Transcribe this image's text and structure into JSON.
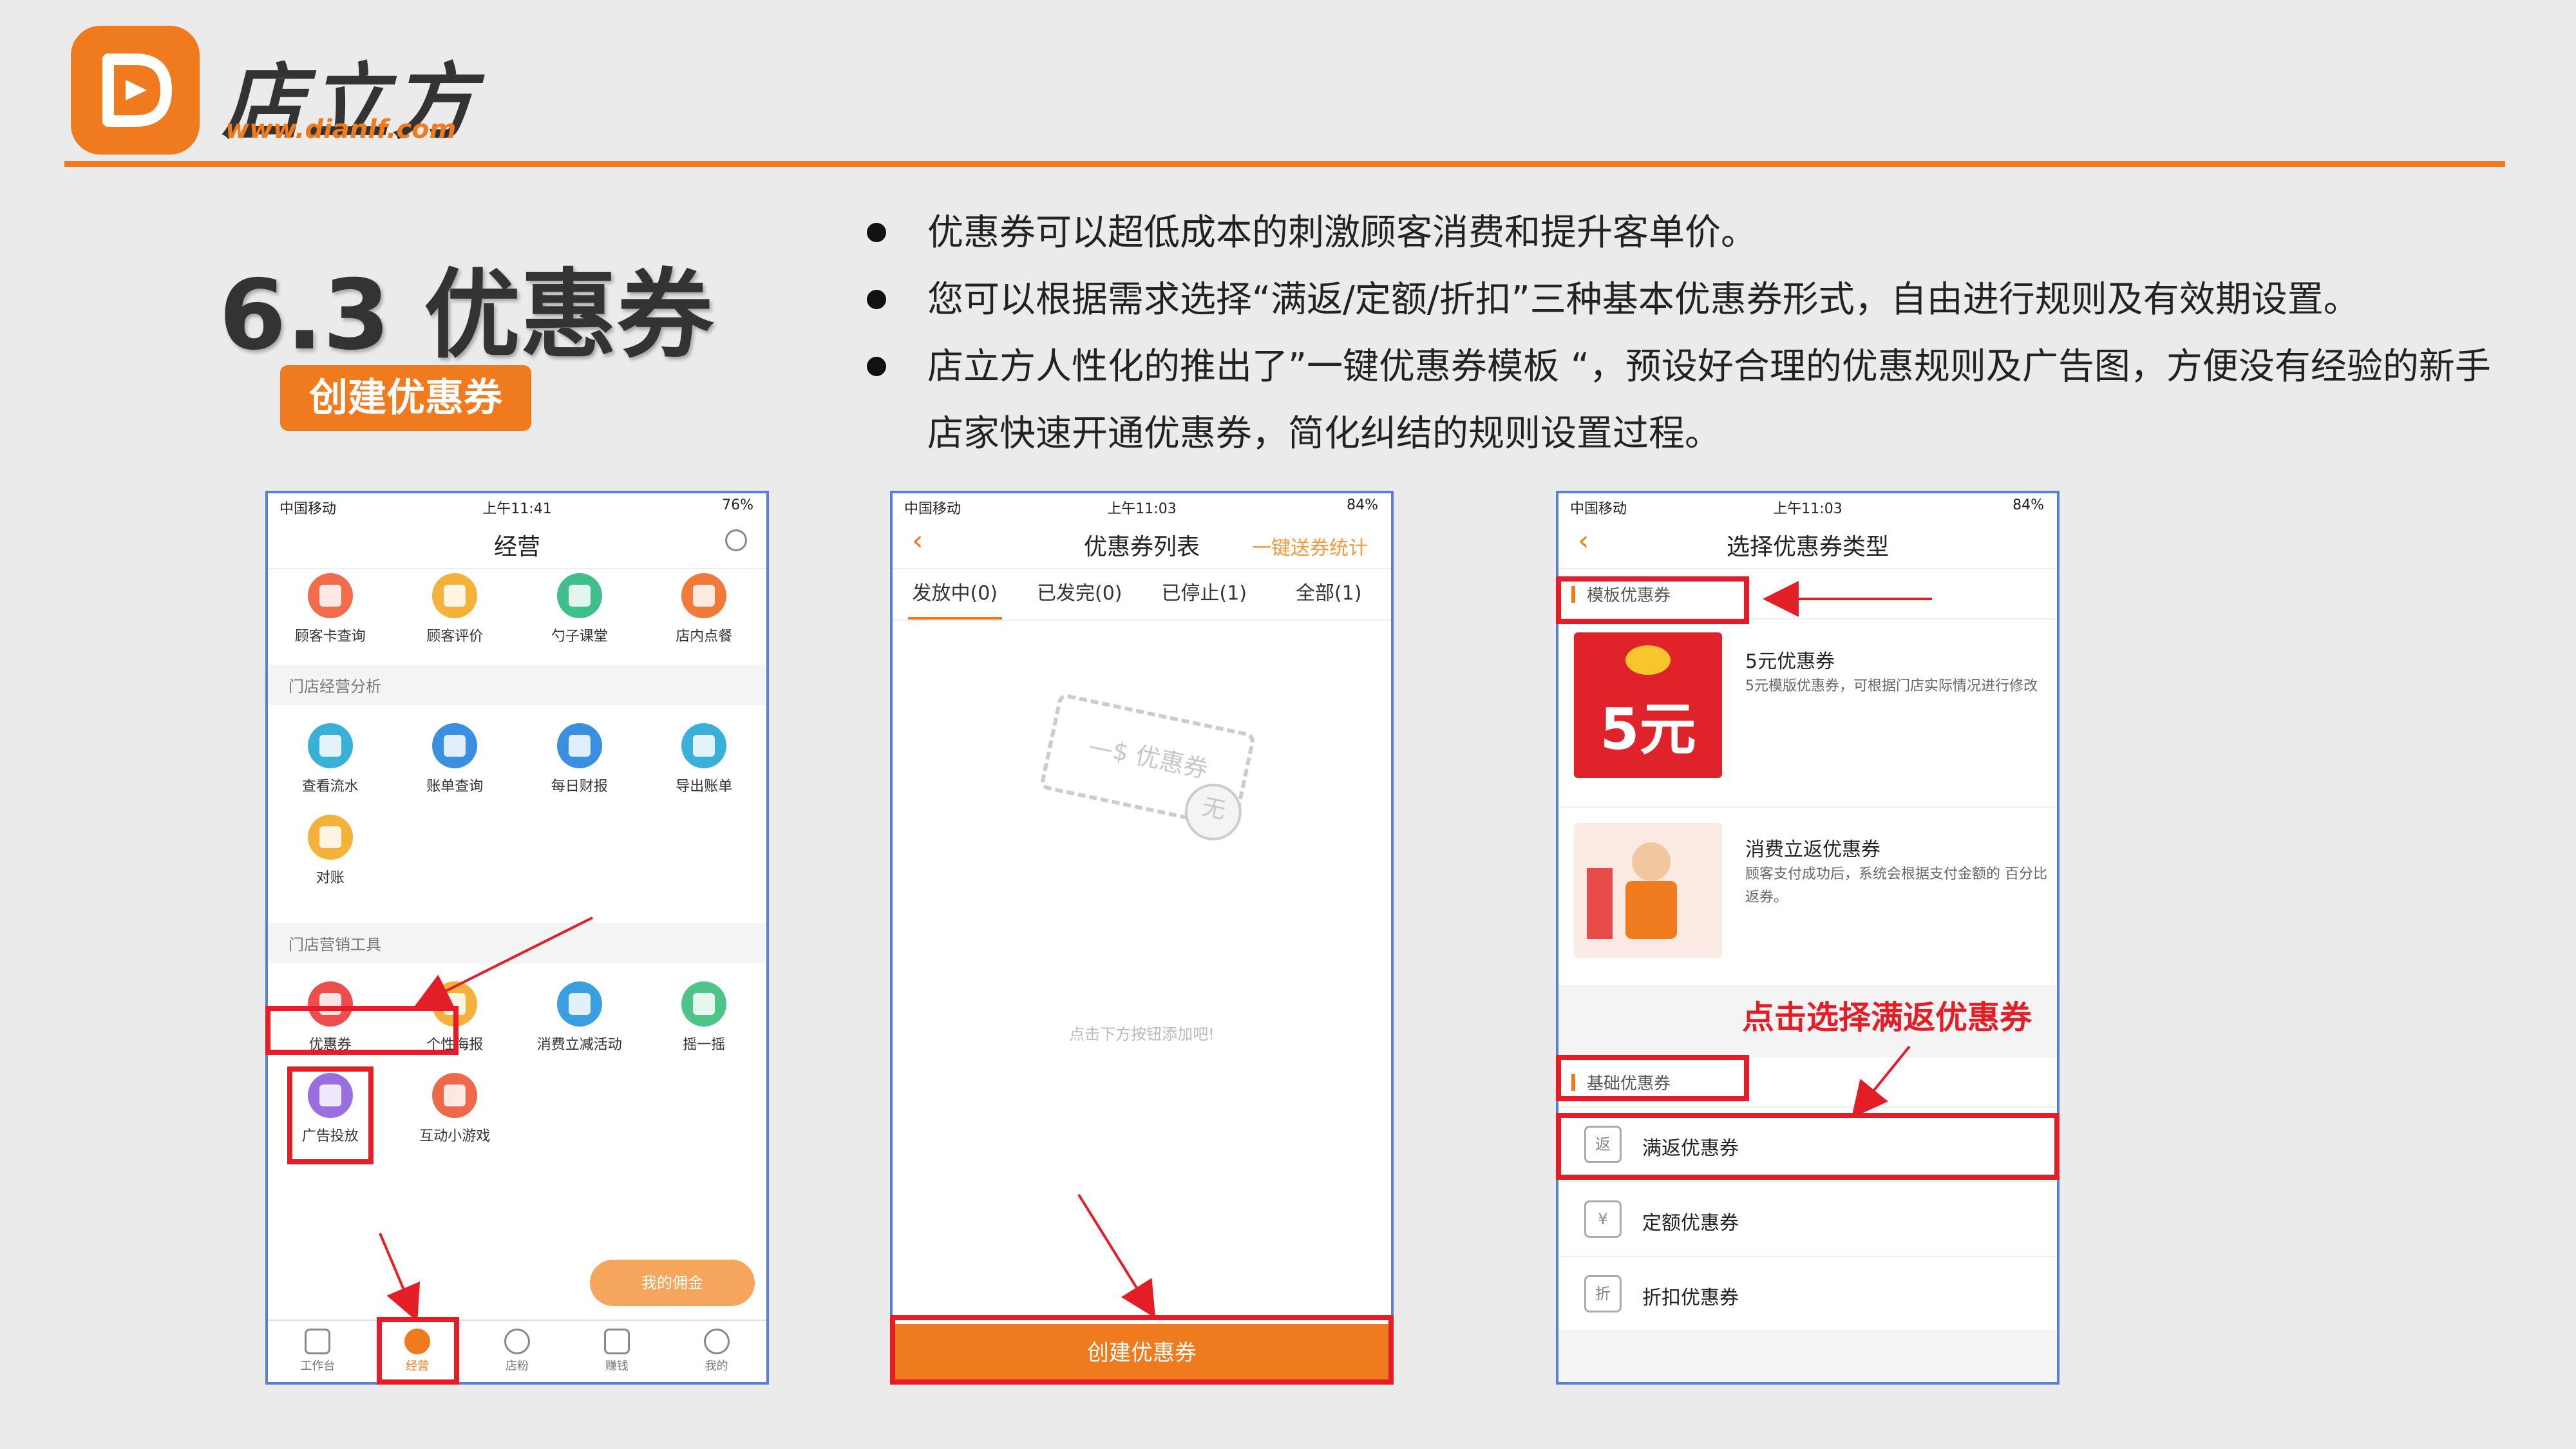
{
  "brand": {
    "name": "店立方",
    "url": "www.dianlf.com"
  },
  "slide": {
    "title": "6.3 优惠券",
    "create_button": "创建优惠券",
    "bullets": [
      "优惠券可以超低成本的刺激顾客消费和提升客单价。",
      "您可以根据需求选择“满返/定额/折扣”三种基本优惠券形式，自由进行规则及有效期设置。",
      "店立方人性化的推出了”一键优惠券模板 “，预设好合理的优惠规则及广告图，方便没有经验的新手店家快速开通优惠券，简化纠结的规则设置过程。"
    ],
    "annotation": "点击选择满返优惠券"
  },
  "phone1": {
    "status": {
      "carrier": "中国移动",
      "time": "上午11:41",
      "battery": "76%"
    },
    "title": "经营",
    "row1": [
      "顾客卡查询",
      "顾客评价",
      "勺子课堂",
      "店内点餐"
    ],
    "section_analysis": "门店经营分析",
    "row2": [
      "查看流水",
      "账单查询",
      "每日财报",
      "导出账单"
    ],
    "row3": [
      "对账"
    ],
    "section_marketing": "门店营销工具",
    "row4": [
      "优惠券",
      "个性海报",
      "消费立减活动",
      "摇一摇"
    ],
    "row5": [
      "广告投放",
      "互动小游戏"
    ],
    "commission_button": "我的佣金",
    "tabbar": [
      "工作台",
      "经营",
      "店粉",
      "赚钱",
      "我的"
    ],
    "colors": {
      "row1": [
        "#f26b4a",
        "#f5b23a",
        "#3fbf8c",
        "#f07a3a"
      ],
      "row2": [
        "#3ab0d8",
        "#3a8fe0",
        "#3a8fe0",
        "#3ab0d8"
      ],
      "row3": [
        "#f5b23a"
      ],
      "row4": [
        "#ec4e4e",
        "#f5b23a",
        "#3a9ee0",
        "#4fc48a"
      ],
      "row5": [
        "#9b6ee0",
        "#f0684a"
      ]
    }
  },
  "phone2": {
    "status": {
      "carrier": "中国移动",
      "time": "上午11:03",
      "battery": "84%"
    },
    "title": "优惠券列表",
    "right_link": "一键送券统计",
    "tabs": [
      "发放中(0)",
      "已发完(0)",
      "已停止(1)",
      "全部(1)"
    ],
    "stamp_text": "—$ 优惠券",
    "stamp_mark": "无",
    "empty_hint": "点击下方按钮添加吧!",
    "create_button": "创建优惠券"
  },
  "phone3": {
    "status": {
      "carrier": "中国移动",
      "time": "上午11:03",
      "battery": "84%"
    },
    "title": "选择优惠券类型",
    "template_section": "模板优惠券",
    "card1": {
      "badge": "5元",
      "title": "5元优惠券",
      "desc": "5元模版优惠券，可根据门店实际情况进行修改"
    },
    "card2": {
      "title": "消费立返优惠券",
      "desc": "顾客支付成功后，系统会根据支付金额的 百分比返券。"
    },
    "basic_section": "基础优惠券",
    "items": [
      {
        "icon": "返",
        "label": "满返优惠券"
      },
      {
        "icon": "¥",
        "label": "定额优惠券"
      },
      {
        "icon": "折",
        "label": "折扣优惠券"
      }
    ]
  }
}
